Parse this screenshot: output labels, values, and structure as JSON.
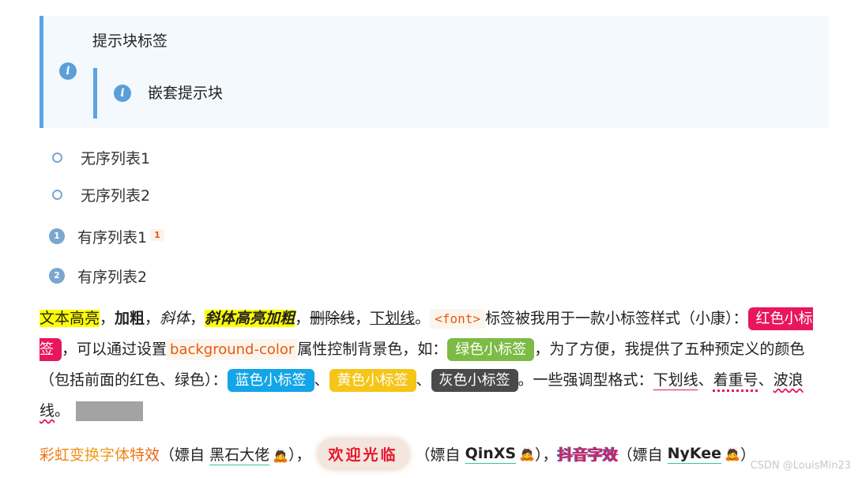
{
  "callout": {
    "title": "提示块标签",
    "icon": "info-circle-icon",
    "nested_text": "嵌套提示块"
  },
  "unordered_list": [
    "无序列表1",
    "无序列表2"
  ],
  "ordered_list": {
    "items": [
      {
        "number": "1",
        "text": "有序列表1",
        "footnote": "1"
      },
      {
        "number": "2",
        "text": "有序列表2",
        "footnote": ""
      }
    ]
  },
  "paragraph": {
    "highlight": "文本高亮",
    "sep1": "，",
    "bold": "加粗",
    "sep2": "，",
    "italic": "斜体",
    "sep3": "，",
    "bold_italic_highlight": "斜体高亮加粗",
    "sep4": "，",
    "strike": "删除线",
    "sep5": "，",
    "underline": "下划线",
    "sep6": "。",
    "code_font": "<font>",
    "text1": "标签被我用于一款小标签样式（小康）：",
    "tag_red": "红色小标签",
    "text2": "，可以通过设置",
    "code_bg": "background-color",
    "text3": "属性控制背景色，如：",
    "tag_green": "绿色小标签",
    "text4": "，为了方便，我提供了五种预定义的颜色（包括前面的红色、绿色）：",
    "tag_blue": "蓝色小标签",
    "sep7": "、",
    "tag_yellow": "黄色小标签",
    "sep8": "、",
    "tag_gray": "灰色小标签",
    "text5": "。一些强调型格式：",
    "emph_underline": "下划线",
    "sep9": "、",
    "emph_dots": "着重号",
    "sep10": "、",
    "emph_wavy": "波浪线",
    "sep11": "。"
  },
  "rainbow_line": {
    "rainbow_text": "彩虹变换字体特效",
    "credit1_prefix": "（嫖自 ",
    "credit1_name": "黑石大佬",
    "credit1_suffix": "），",
    "welcome": "欢迎光临",
    "credit2_prefix": "（嫖自 ",
    "credit2_name": "QinXS",
    "credit2_suffix": "），",
    "douyin": "抖音字效",
    "credit3_prefix": "（嫖自 ",
    "credit3_name": "NyKee",
    "credit3_suffix": "）",
    "person_icon": "🙇"
  },
  "watermark": "CSDN @LouisMin23",
  "colors": {
    "callout_border": "#5ea4e3",
    "callout_bg": "#f4f9fe",
    "tag_red": "#e8175d",
    "tag_green": "#7cbb45",
    "tag_blue": "#13a5e7",
    "tag_yellow": "#f5c518",
    "tag_gray": "#4a4a4a",
    "highlight": "#ffff00"
  }
}
